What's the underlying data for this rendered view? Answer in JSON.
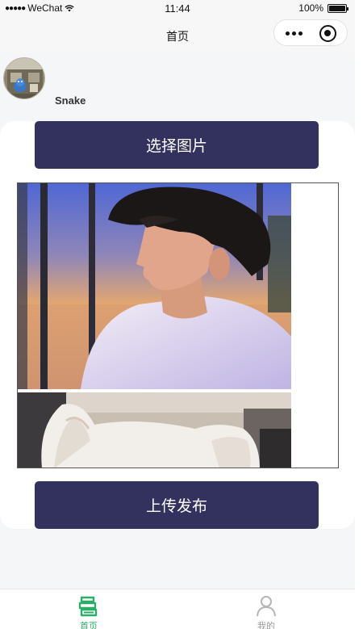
{
  "status_bar": {
    "carrier": "WeChat",
    "time": "11:44",
    "battery_text": "100%",
    "battery_level": 1.0
  },
  "nav": {
    "title": "首页"
  },
  "user": {
    "name": "Snake"
  },
  "actions": {
    "choose_label": "选择图片",
    "upload_label": "上传发布"
  },
  "tab_bar": {
    "items": [
      {
        "label": "首页",
        "icon": "book-stack-icon",
        "active": true
      },
      {
        "label": "我的",
        "icon": "person-icon",
        "active": false
      }
    ]
  },
  "colors": {
    "button": "#33325f",
    "tab_active": "#2aae67",
    "tab_inactive": "#999999"
  }
}
